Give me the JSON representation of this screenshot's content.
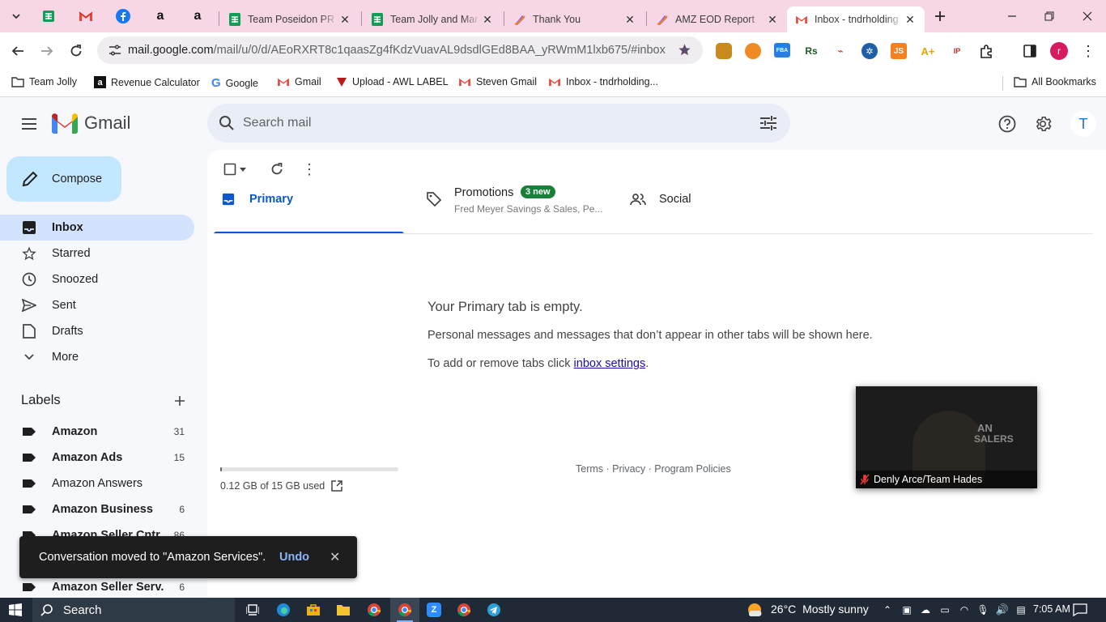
{
  "browser": {
    "tabs": [
      {
        "title": "Team Poseidon PR S",
        "icon": "sheets-icon"
      },
      {
        "title": "Team Jolly and Mar",
        "icon": "sheets-icon"
      },
      {
        "title": "Thank You",
        "icon": "clickup-icon"
      },
      {
        "title": "AMZ EOD Report",
        "icon": "clickup-icon"
      },
      {
        "title": "Inbox - tndrholding",
        "icon": "gmail-icon"
      }
    ],
    "url_host": "mail.google.com",
    "url_path": "/mail/u/0/d/AEoRXRT8c1qaasZg4fKdzVuavAL9dsdlGEd8BAA_yRWmM1lxb675/#inbox",
    "profile_letter": "r",
    "bookmarks": [
      {
        "label": "Team Jolly",
        "icon": "folder-icon"
      },
      {
        "label": "Revenue Calculator",
        "icon": "amazon-icon"
      },
      {
        "label": "Google",
        "icon": "google-icon"
      },
      {
        "label": "Gmail",
        "icon": "gmail-icon"
      },
      {
        "label": "Upload - AWL LABEL",
        "icon": "awl-icon"
      },
      {
        "label": "Steven Gmail",
        "icon": "gmail-icon"
      },
      {
        "label": "Inbox - tndrholding...",
        "icon": "gmail-icon"
      }
    ],
    "all_bookmarks": "All Bookmarks"
  },
  "gmail": {
    "logo_text": "Gmail",
    "search_placeholder": "Search mail",
    "account_letter": "T",
    "compose_label": "Compose",
    "nav": [
      {
        "label": "Inbox",
        "icon": "inbox-icon"
      },
      {
        "label": "Starred",
        "icon": "star-icon"
      },
      {
        "label": "Snoozed",
        "icon": "clock-icon"
      },
      {
        "label": "Sent",
        "icon": "send-icon"
      },
      {
        "label": "Drafts",
        "icon": "draft-icon"
      },
      {
        "label": "More",
        "icon": "chevron-down-icon"
      }
    ],
    "labels_heading": "Labels",
    "labels": [
      {
        "name": "Amazon",
        "count": "31",
        "bold": true
      },
      {
        "name": "Amazon Ads",
        "count": "15",
        "bold": true
      },
      {
        "name": "Amazon Answers",
        "count": "",
        "bold": false
      },
      {
        "name": "Amazon Business",
        "count": "6",
        "bold": true
      },
      {
        "name": "Amazon Seller Cntr",
        "count": "86",
        "bold": true
      },
      {
        "name": "Amazon Seller Serv.",
        "count": "6",
        "bold": true
      }
    ],
    "tabs": {
      "primary": "Primary",
      "promotions": "Promotions",
      "promotions_badge": "3 new",
      "promotions_snippet": "Fred Meyer Savings & Sales, Pe...",
      "social": "Social"
    },
    "empty": {
      "title": "Your Primary tab is empty.",
      "line1": "Personal messages and messages that don’t appear in other tabs will be shown here.",
      "line2_prefix": "To add or remove tabs click ",
      "line2_link": "inbox settings",
      "line2_suffix": "."
    },
    "storage": {
      "text": "0.12 GB of 15 GB used",
      "fraction": 0.008
    },
    "footer": {
      "terms": "Terms",
      "privacy": "Privacy",
      "policies": "Program Policies",
      "sep": " · "
    },
    "toast": {
      "message": "Conversation moved to \"Amazon Services\".",
      "undo": "Undo"
    },
    "video": {
      "name": "Denly Arce/Team Hades",
      "bg_text_1": "AN",
      "bg_text_2": "SALERS"
    }
  },
  "taskbar": {
    "search": "Search",
    "temperature": "26°C",
    "weather": "Mostly sunny",
    "time": "7:05 AM"
  }
}
